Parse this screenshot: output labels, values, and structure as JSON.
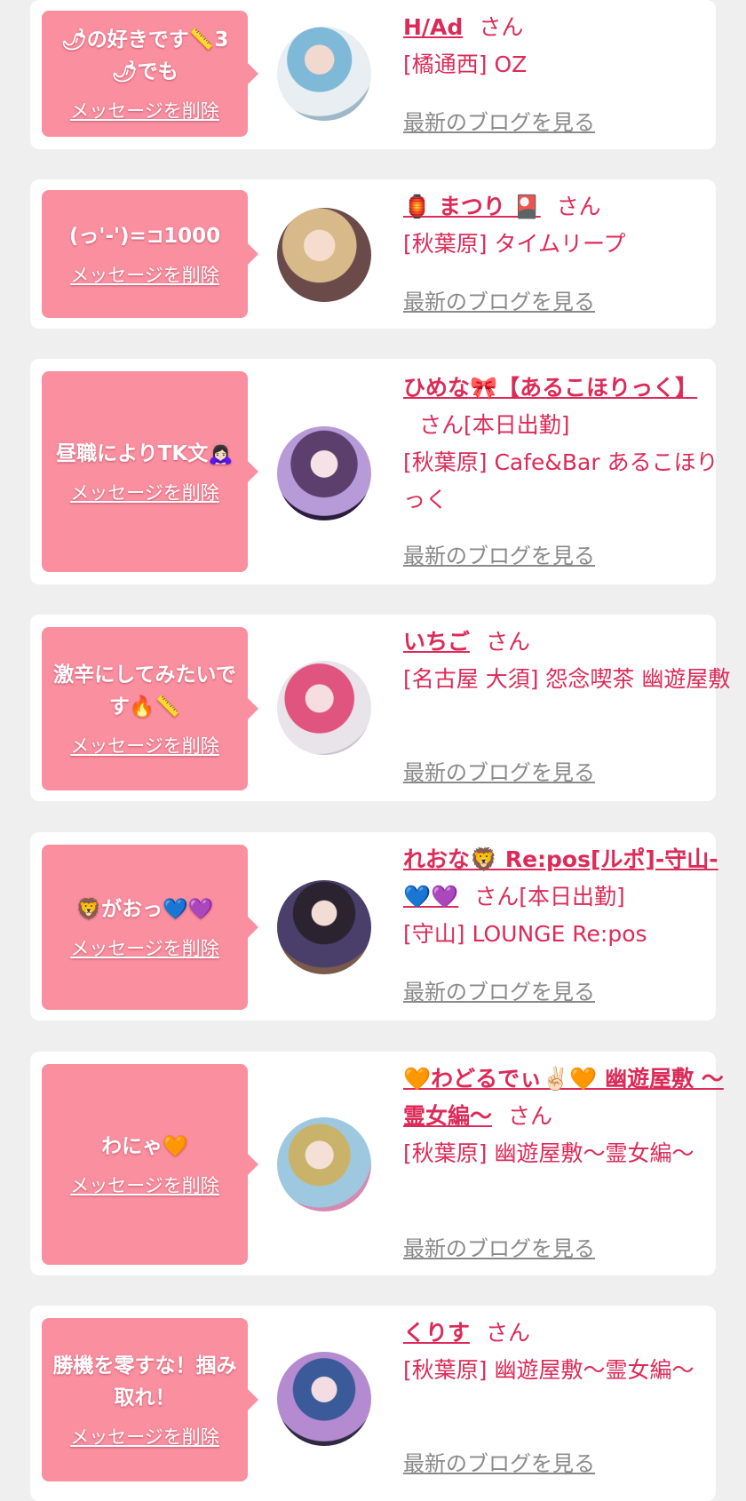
{
  "colors": {
    "accent": "#dc2b58",
    "bubble": "#fa8fa0",
    "background": "#efefef"
  },
  "delete_label": "メッセージを削除",
  "blog_label": "最新のブログを見る",
  "cards": [
    {
      "message": "🌶の好きです📏3🌶でも",
      "name": "H/Ad",
      "san": "さん",
      "shop": "[橘通西] OZ"
    },
    {
      "message": "(っ'-')=⊐1000",
      "name": "🏮 まつり 🎴",
      "san": "さん",
      "shop": "[秋葉原] タイムリープ"
    },
    {
      "message": "昼職によりTK文🙇🏻‍♀️",
      "name": "ひめな🎀【あるこほりっく】",
      "san": "さん[本日出勤]",
      "shop": "[秋葉原] Cafe&Bar あるこほりっく"
    },
    {
      "message": "激辛にしてみたいです🔥📏",
      "name": "いちご",
      "san": "さん",
      "shop": "[名古屋 大須] 怨念喫茶 幽遊屋敷"
    },
    {
      "message": "🦁がおっ💙💜",
      "name": "れおな🦁 Re:pos[ルポ]-守山-💙💜",
      "san": "さん[本日出勤]",
      "shop": "[守山] LOUNGE Re:pos"
    },
    {
      "message": "わにゃ🧡",
      "name": "🧡わどるでぃ✌🏻🧡 幽遊屋敷 〜霊女編〜",
      "san": "さん",
      "shop": "[秋葉原] 幽遊屋敷〜霊女編〜"
    },
    {
      "message": "勝機を零すな！掴み取れ！",
      "name": "くりす",
      "san": "さん",
      "shop": "[秋葉原] 幽遊屋敷〜霊女編〜"
    }
  ]
}
